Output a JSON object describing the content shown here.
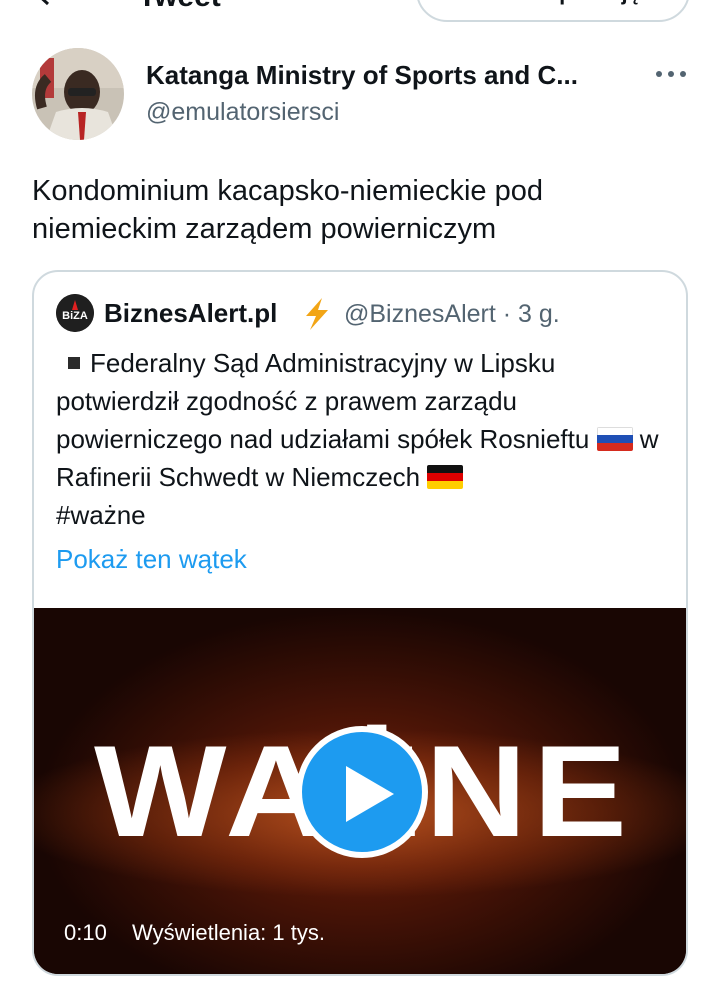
{
  "topbar": {
    "title": "Tweet",
    "open_app_label": "Otwórz aplikację"
  },
  "author": {
    "name": "Katanga Ministry of Sports and C...",
    "handle": "@emulatorsiersci"
  },
  "tweet": {
    "text": "Kondominium kacapsko-niemieckie pod niemieckim zarządem powierniczym"
  },
  "quote": {
    "name": "BiznesAlert.pl",
    "handle_time": "@BiznesAlert · 3 g.",
    "body_part1": "Federalny Sąd Administracyjny w Lipsku potwierdził zgodność z prawem zarządu powierniczego nad udziałami spółek Rosnieftu",
    "body_part2": "w Rafinerii Schwedt w Niemczech",
    "hashtag": "#ważne",
    "show_thread": "Pokaż ten wątek",
    "logo_text": "BiZA"
  },
  "video": {
    "word": "WAŻNE",
    "time": "0:10",
    "views": "Wyświetlenia: 1 tys."
  },
  "colors": {
    "accent": "#1d9bf0",
    "secondary_text": "#536471",
    "border": "#cfd9de"
  }
}
